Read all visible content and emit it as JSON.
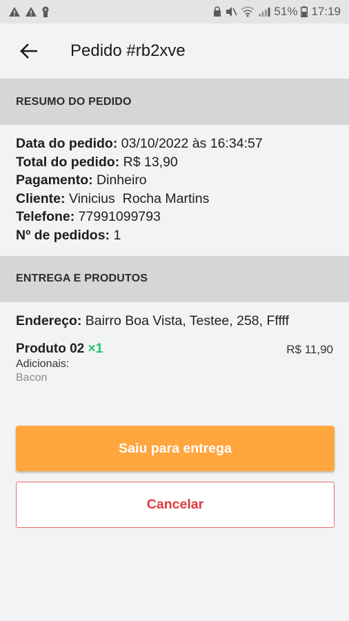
{
  "status_bar": {
    "left_icons": [
      "warning-icon",
      "warning-icon",
      "keyhole-icon"
    ],
    "battery_percent": "51%",
    "time": "17:19"
  },
  "header": {
    "title": "Pedido #rb2xve"
  },
  "summary": {
    "section_title": "RESUMO DO PEDIDO",
    "order_date_label": "Data do pedido:",
    "order_date_value": "03/10/2022 às 16:34:57",
    "total_label": "Total do pedido:",
    "total_value": "R$ 13,90",
    "payment_label": "Pagamento:",
    "payment_value": "Dinheiro",
    "client_label": "Cliente:",
    "client_value": "Vinicius  Rocha Martins",
    "phone_label": "Telefone:",
    "phone_value": "77991099793",
    "orders_count_label": "Nº de pedidos:",
    "orders_count_value": "1"
  },
  "delivery": {
    "section_title": "ENTREGA E PRODUTOS",
    "address_label": "Endereço:",
    "address_value": "Bairro Boa Vista, Testee, 258, Fffff",
    "products": [
      {
        "name": "Produto 02",
        "quantity": "×1",
        "price": "R$ 11,90",
        "additions_label": "Adicionais:",
        "additions": "Bacon"
      }
    ]
  },
  "actions": {
    "primary_label": "Saiu para entrega",
    "cancel_label": "Cancelar"
  },
  "colors": {
    "primary": "#ffa63f",
    "cancel": "#e0393e",
    "quantity": "#1fc36b",
    "section_bg": "#d6d6d6"
  }
}
